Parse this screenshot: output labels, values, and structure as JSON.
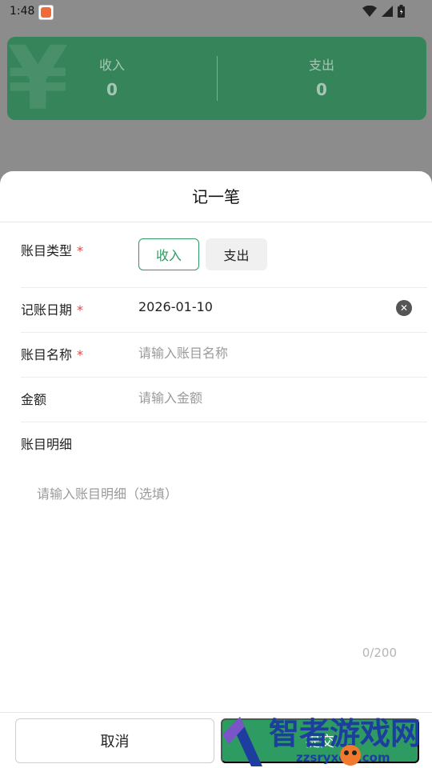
{
  "status_bar": {
    "time": "1:48"
  },
  "summary": {
    "watermark_symbol": "¥",
    "income_label": "收入",
    "income_value": "0",
    "expense_label": "支出",
    "expense_value": "0"
  },
  "sheet": {
    "title": "记一笔",
    "required_mark": "*",
    "type_label": "账目类型",
    "type_options": [
      "收入",
      "支出"
    ],
    "selected_type": "收入",
    "date_label": "记账日期",
    "date_value": "2026-01-10",
    "name_label": "账目名称",
    "name_placeholder": "请输入账目名称",
    "amount_label": "金额",
    "amount_placeholder": "请输入金额",
    "detail_label": "账目明细",
    "detail_placeholder": "请输入账目明细（选填）",
    "char_count": "0/200",
    "cancel_label": "取消",
    "confirm_label": "提交"
  },
  "watermark": {
    "text_cn": "智者游戏网",
    "text_en": "zzsryxcfy.com"
  },
  "colors": {
    "accent": "#2e9b62",
    "required": "#e24545",
    "card": "#35845a"
  },
  "icons": [
    "battery-icon",
    "signal-icon",
    "wifi-icon",
    "clear-icon",
    "app-notification-icon"
  ]
}
